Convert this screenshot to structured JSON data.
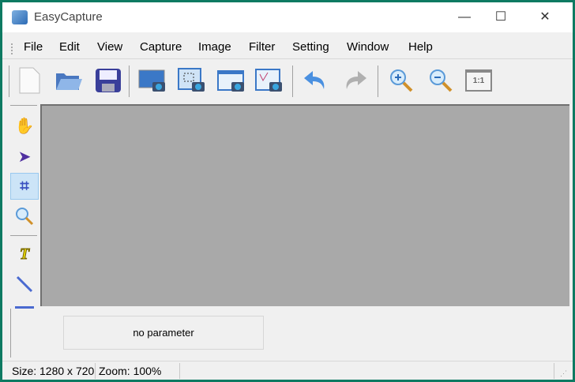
{
  "window": {
    "title": "EasyCapture",
    "minimize": "—",
    "maximize": "☐",
    "close": "✕"
  },
  "menu": [
    "File",
    "Edit",
    "View",
    "Capture",
    "Image",
    "Filter",
    "Setting",
    "Window",
    "Help"
  ],
  "toolbar": {
    "zoom_actual_label": "1:1"
  },
  "panel": {
    "parameter_text": "no parameter"
  },
  "status": {
    "size": "Size: 1280 x 720",
    "zoom": "Zoom: 100%"
  },
  "colors": {
    "canvas": "#a9a9a9",
    "border": "#0e7a62",
    "active_tool": "#cce4f7"
  }
}
